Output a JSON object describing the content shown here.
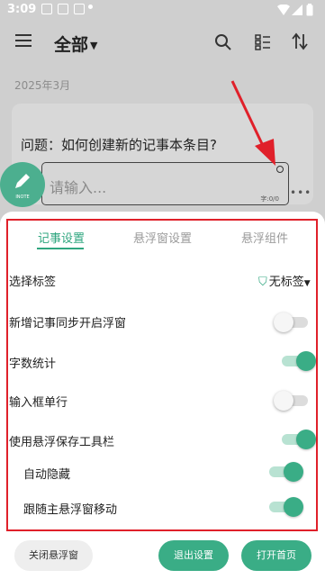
{
  "status_bar": {
    "time": "3:09"
  },
  "app_bar": {
    "title": "全部"
  },
  "month": "2025年3月",
  "note": {
    "question": "问题：如何创建新的记事本条目?",
    "input_placeholder": "请输入...",
    "char_count": "字:0/0",
    "pen_label": "INOTE",
    "more": "•••"
  },
  "tabs": [
    {
      "label": "记事设置",
      "active": true
    },
    {
      "label": "悬浮窗设置",
      "active": false
    },
    {
      "label": "悬浮组件",
      "active": false
    }
  ],
  "settings": {
    "tag_label": "选择标签",
    "tag_value": "无标签",
    "sync_label": "新增记事同步开启浮窗",
    "word_count_label": "字数统计",
    "single_line_label": "输入框单行",
    "toolbar_label": "使用悬浮保存工具栏",
    "auto_hide_label": "自动隐藏",
    "follow_label": "跟随主悬浮窗移动"
  },
  "toggles": {
    "sync": false,
    "word_count": true,
    "single_line": false,
    "toolbar": true,
    "auto_hide": true,
    "follow": true
  },
  "buttons": {
    "close_float": "关闭悬浮窗",
    "exit_settings": "退出设置",
    "open_home": "打开首页"
  },
  "colors": {
    "accent": "#3aad86",
    "highlight_box": "#e0202a",
    "arrow": "#e0202a"
  }
}
